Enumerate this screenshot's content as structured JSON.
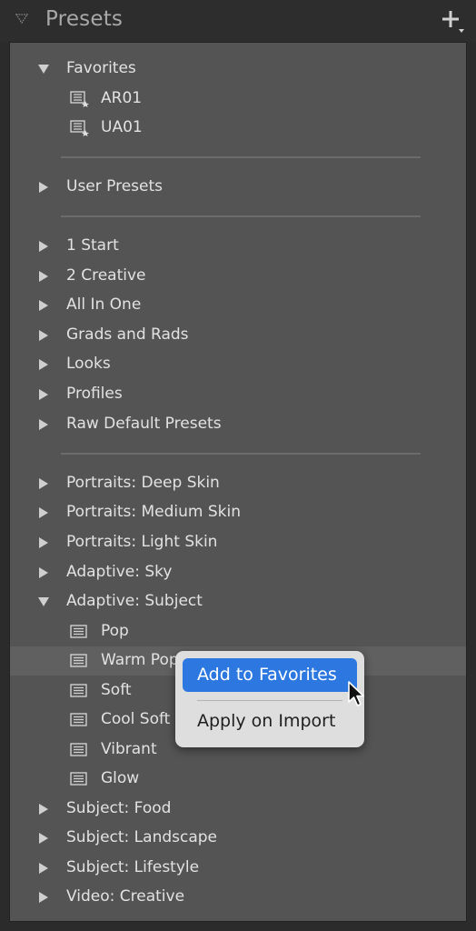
{
  "header": {
    "title": "Presets"
  },
  "favorites": {
    "label": "Favorites",
    "items": [
      "AR01",
      "UA01"
    ]
  },
  "user_presets": "User Presets",
  "groups_a": [
    "1 Start",
    "2 Creative",
    "All In One",
    "Grads and Rads",
    "Looks",
    "Profiles",
    "Raw Default Presets"
  ],
  "groups_b": [
    "Portraits: Deep Skin",
    "Portraits: Medium Skin",
    "Portraits: Light Skin",
    "Adaptive: Sky"
  ],
  "adaptive_subject": {
    "label": "Adaptive: Subject",
    "items": [
      "Pop",
      "Warm Pop",
      "Soft",
      "Cool Soft",
      "Vibrant",
      "Glow"
    ]
  },
  "groups_c": [
    "Subject: Food",
    "Subject: Landscape",
    "Subject: Lifestyle",
    "Video: Creative"
  ],
  "context_menu": {
    "items": [
      "Add to Favorites",
      "Apply on Import"
    ]
  },
  "colors": {
    "panel": "#545454",
    "menu_highlight": "#2d78e0",
    "text": "#e2e2e2"
  }
}
